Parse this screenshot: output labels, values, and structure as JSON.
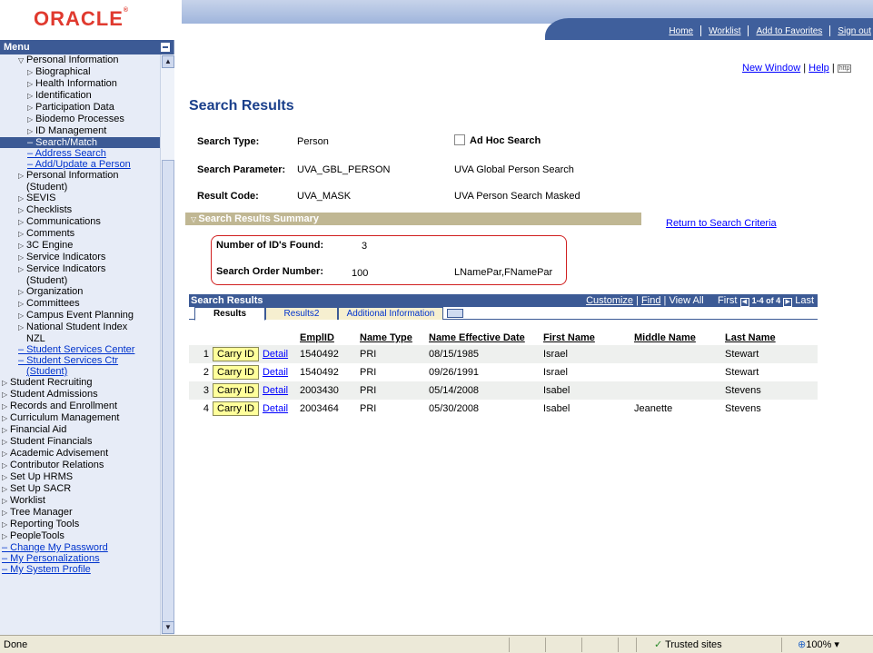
{
  "brand": {
    "logo": "ORACLE",
    "mark": "®"
  },
  "toplinks": [
    "Home",
    "Worklist",
    "Add to Favorites",
    "Sign out"
  ],
  "menu": {
    "title": "Menu",
    "items": [
      {
        "label": "Personal Information",
        "indent": 1,
        "icon": "triangle-down"
      },
      {
        "label": "Biographical",
        "indent": 2,
        "icon": "triangle-right"
      },
      {
        "label": "Health Information",
        "indent": 2,
        "icon": "triangle-right"
      },
      {
        "label": "Identification",
        "indent": 2,
        "icon": "triangle-right"
      },
      {
        "label": "Participation Data",
        "indent": 2,
        "icon": "triangle-right"
      },
      {
        "label": "Biodemo Processes",
        "indent": 2,
        "icon": "triangle-right"
      },
      {
        "label": "ID Management",
        "indent": 2,
        "icon": "triangle-right"
      },
      {
        "label": "– Search/Match",
        "indent": 2,
        "selected": true
      },
      {
        "label": "– Address Search",
        "indent": 2,
        "link": true
      },
      {
        "label": "– Add/Update a Person",
        "indent": 2,
        "link": true
      },
      {
        "label": "Personal Information",
        "indent": 1,
        "icon": "triangle-right"
      },
      {
        "label": "(Student)",
        "indent": 1,
        "cont": true
      },
      {
        "label": "SEVIS",
        "indent": 1,
        "icon": "triangle-right"
      },
      {
        "label": "Checklists",
        "indent": 1,
        "icon": "triangle-right"
      },
      {
        "label": "Communications",
        "indent": 1,
        "icon": "triangle-right"
      },
      {
        "label": "Comments",
        "indent": 1,
        "icon": "triangle-right"
      },
      {
        "label": "3C Engine",
        "indent": 1,
        "icon": "triangle-right"
      },
      {
        "label": "Service Indicators",
        "indent": 1,
        "icon": "triangle-right"
      },
      {
        "label": "Service Indicators",
        "indent": 1,
        "icon": "triangle-right"
      },
      {
        "label": "(Student)",
        "indent": 1,
        "cont": true
      },
      {
        "label": "Organization",
        "indent": 1,
        "icon": "triangle-right"
      },
      {
        "label": "Committees",
        "indent": 1,
        "icon": "triangle-right"
      },
      {
        "label": "Campus Event Planning",
        "indent": 1,
        "icon": "triangle-right"
      },
      {
        "label": "National Student Index",
        "indent": 1,
        "icon": "triangle-right"
      },
      {
        "label": "NZL",
        "indent": 1,
        "cont": true
      },
      {
        "label": "– Student Services Center",
        "indent": 1,
        "link": true
      },
      {
        "label": "– Student Services Ctr",
        "indent": 1,
        "link": true
      },
      {
        "label": "(Student)",
        "indent": 1,
        "link": true,
        "cont": true
      },
      {
        "label": "Student Recruiting",
        "indent": 0,
        "icon": "triangle-right"
      },
      {
        "label": "Student Admissions",
        "indent": 0,
        "icon": "triangle-right"
      },
      {
        "label": "Records and Enrollment",
        "indent": 0,
        "icon": "triangle-right"
      },
      {
        "label": "Curriculum Management",
        "indent": 0,
        "icon": "triangle-right"
      },
      {
        "label": "Financial Aid",
        "indent": 0,
        "icon": "triangle-right"
      },
      {
        "label": "Student Financials",
        "indent": 0,
        "icon": "triangle-right"
      },
      {
        "label": "Academic Advisement",
        "indent": 0,
        "icon": "triangle-right"
      },
      {
        "label": "Contributor Relations",
        "indent": 0,
        "icon": "triangle-right"
      },
      {
        "label": "Set Up HRMS",
        "indent": 0,
        "icon": "triangle-right"
      },
      {
        "label": "Set Up SACR",
        "indent": 0,
        "icon": "triangle-right"
      },
      {
        "label": "Worklist",
        "indent": 0,
        "icon": "triangle-right"
      },
      {
        "label": "Tree Manager",
        "indent": 0,
        "icon": "triangle-right"
      },
      {
        "label": "Reporting Tools",
        "indent": 0,
        "icon": "triangle-right"
      },
      {
        "label": "PeopleTools",
        "indent": 0,
        "icon": "triangle-right"
      },
      {
        "label": "– Change My Password",
        "indent": 0,
        "link": true
      },
      {
        "label": "– My Personalizations",
        "indent": 0,
        "link": true
      },
      {
        "label": "– My System Profile",
        "indent": 0,
        "link": true
      }
    ]
  },
  "header_links": {
    "new_window": "New Window",
    "help": "Help",
    "http_icon": "http"
  },
  "page_title": "Search Results",
  "search": {
    "type_label": "Search Type:",
    "type_value": "Person",
    "adhoc_label": "Ad Hoc Search",
    "param_label": "Search Parameter:",
    "param_value": "UVA_GBL_PERSON",
    "param_desc": "UVA Global Person Search",
    "code_label": "Result Code:",
    "code_value": "UVA_MASK",
    "code_desc": "UVA Person Search Masked"
  },
  "summary": {
    "title": "Search Results Summary",
    "return_link": "Return to Search Criteria",
    "ids_label": "Number of ID's Found:",
    "ids_value": "3",
    "order_label": "Search Order Number:",
    "order_value": "100",
    "order_desc": "LNamePar,FNamePar"
  },
  "grid": {
    "title": "Search Results",
    "customize": "Customize",
    "find": "Find",
    "view_all": "View All",
    "first": "First",
    "range": "1-4 of 4",
    "last": "Last",
    "tabs": [
      "Results",
      "Results2",
      "Additional Information"
    ],
    "columns": [
      "EmplID",
      "Name Type",
      "Name Effective Date",
      "First Name",
      "Middle Name",
      "Last Name"
    ],
    "carry_label": "Carry ID",
    "detail_label": "Detail",
    "rows": [
      {
        "n": "1",
        "emplid": "1540492",
        "type": "PRI",
        "date": "08/15/1985",
        "first": "Israel",
        "middle": "",
        "last": "Stewart"
      },
      {
        "n": "2",
        "emplid": "1540492",
        "type": "PRI",
        "date": "09/26/1991",
        "first": "Israel",
        "middle": "",
        "last": "Stewart"
      },
      {
        "n": "3",
        "emplid": "2003430",
        "type": "PRI",
        "date": "05/14/2008",
        "first": "Isabel",
        "middle": "",
        "last": "Stevens"
      },
      {
        "n": "4",
        "emplid": "2003464",
        "type": "PRI",
        "date": "05/30/2008",
        "first": "Isabel",
        "middle": "Jeanette",
        "last": "Stevens"
      }
    ]
  },
  "status": {
    "left": "Done",
    "zone": "Trusted sites",
    "zoom": "100%"
  }
}
